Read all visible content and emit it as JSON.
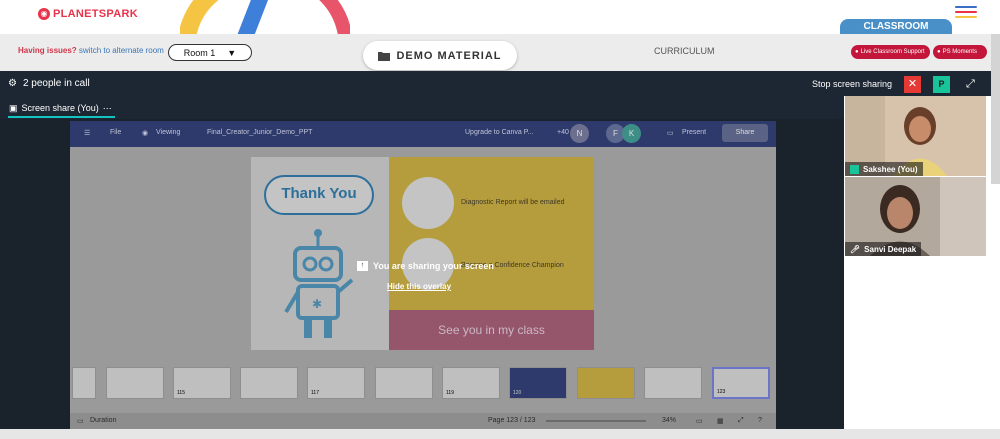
{
  "header": {
    "logo_text": "PLANETSPARK",
    "classroom_tab": "CLASSROOM"
  },
  "subbar": {
    "issues_text": "Having issues?",
    "switch_link": "switch to alternate room",
    "room_selected": "Room 1",
    "demo_material": "DEMO MATERIAL",
    "curriculum": "CURRICULUM",
    "live_support": "Live Classroom Support",
    "ps_moments": "PS Moments"
  },
  "call": {
    "people_count": "2 people in call",
    "stop_sharing": "Stop screen sharing",
    "close_label": "✕",
    "p_label": "P",
    "share_tab": "Screen share (You)"
  },
  "canva": {
    "file": "File",
    "viewing": "Viewing",
    "doc_name": "Final_Creator_Junior_Demo_PPT",
    "upgrade": "Upgrade to Canva P...",
    "collab_count": "+40",
    "avatars": [
      "N",
      "F",
      "K"
    ],
    "present": "Present",
    "share": "Share",
    "duration": "Duration",
    "page": "Page 123 / 123",
    "zoom": "34%"
  },
  "slide": {
    "thank_you": "Thank You",
    "line1": "Diagnostic Report will be emailed",
    "line2": "Become a Confidence Champion",
    "see_you": "See you in my class"
  },
  "thumb_numbers": [
    "115",
    "117",
    "119",
    "120",
    "123"
  ],
  "overlay": {
    "title": "You are sharing your screen",
    "hide": "Hide this overlay"
  },
  "participants": [
    {
      "name": "Sakshee (You)"
    },
    {
      "name": "Sanvi Deepak"
    }
  ],
  "colors": {
    "brand_red": "#e8334a",
    "call_bar": "#1d2733",
    "accent_teal": "#13c4c0",
    "support_pill": "#c4153a"
  }
}
